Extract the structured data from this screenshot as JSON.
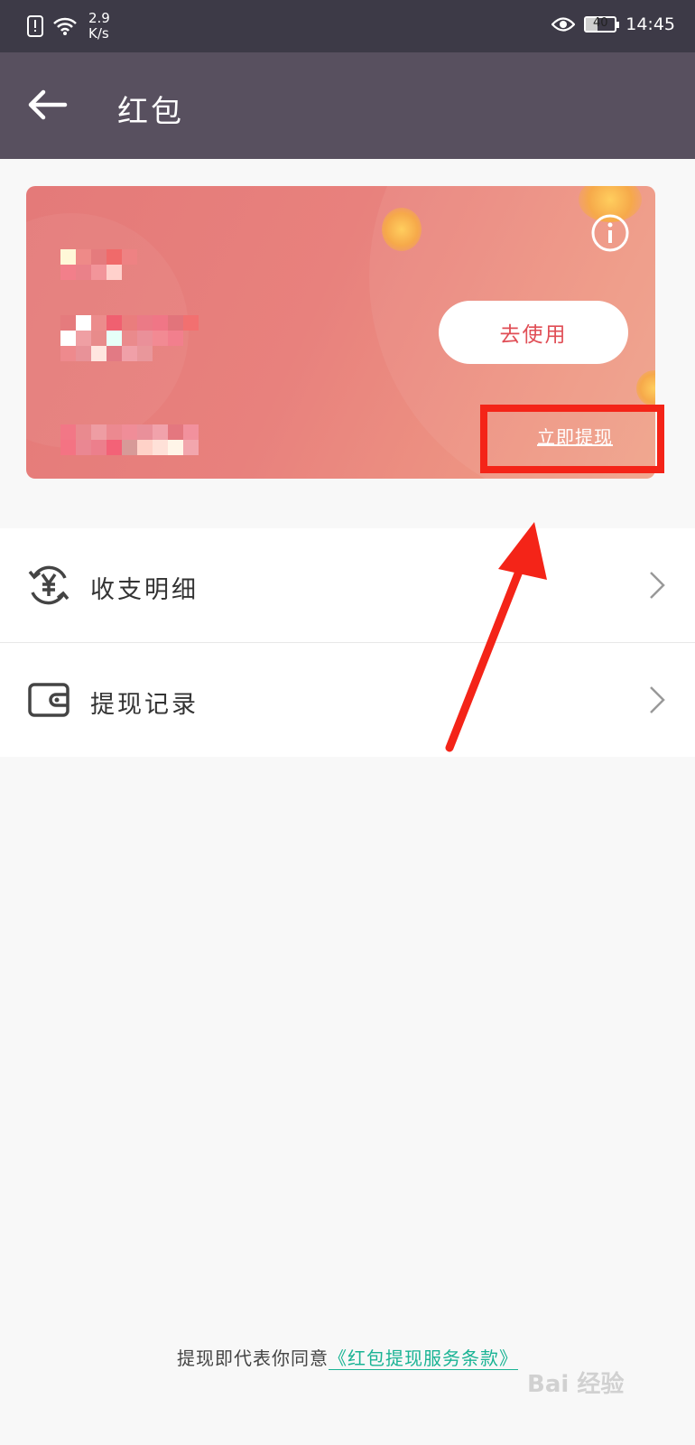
{
  "status_bar": {
    "net_speed_value": "2.9",
    "net_speed_unit": "K/s",
    "battery_level": "40",
    "time": "14:45",
    "icons": [
      "alert-icon",
      "wifi-icon",
      "eye-comfort-icon",
      "battery-icon"
    ]
  },
  "app_bar": {
    "back_icon": "back-arrow-icon",
    "title": "红包"
  },
  "card": {
    "use_button_label": "去使用",
    "withdraw_link_label": "立即提现",
    "info_icon": "info-icon",
    "accent_color": "#e04e56"
  },
  "menu": {
    "items": [
      {
        "label": "收支明细",
        "icon": "yuan-exchange-icon"
      },
      {
        "label": "提现记录",
        "icon": "wallet-icon"
      }
    ]
  },
  "footer": {
    "prefix": "提现即代表你同意",
    "terms_link": "《红包提现服务条款》",
    "watermark": "Bai 经验"
  },
  "annotations": {
    "highlight_color": "#f42418"
  }
}
